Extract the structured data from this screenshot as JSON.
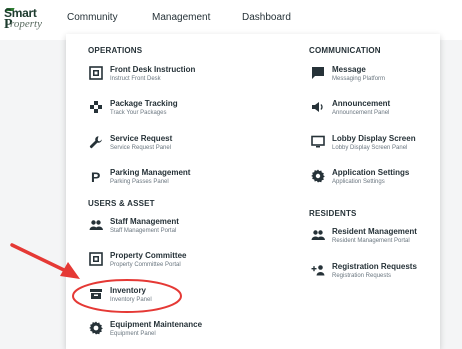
{
  "brand": {
    "line1": "Smart",
    "line2": "roperty",
    "initial": "P"
  },
  "nav": {
    "community": "Community",
    "management": "Management",
    "dashboard": "Dashboard"
  },
  "left": {
    "operations_heading": "OPERATIONS",
    "users_heading": "USERS & ASSET",
    "items": [
      {
        "title": "Front Desk Instruction",
        "sub": "Instruct Front Desk",
        "icon": "front-desk-icon"
      },
      {
        "title": "Package Tracking",
        "sub": "Track Your Packages",
        "icon": "package-icon"
      },
      {
        "title": "Service Request",
        "sub": "Service Request Panel",
        "icon": "wrench-icon"
      },
      {
        "title": "Parking Management",
        "sub": "Parking Passes Panel",
        "icon": "parking-icon"
      },
      {
        "title": "Staff Management",
        "sub": "Staff Management Portal",
        "icon": "people-icon"
      },
      {
        "title": "Property Committee",
        "sub": "Property Committee Portal",
        "icon": "committee-icon"
      },
      {
        "title": "Inventory",
        "sub": "Inventory Panel",
        "icon": "inventory-icon"
      },
      {
        "title": "Equipment Maintenance",
        "sub": "Equipment Panel",
        "icon": "gear-icon"
      }
    ]
  },
  "right": {
    "communication_heading": "COMMUNICATION",
    "residents_heading": "RESIDENTS",
    "items": [
      {
        "title": "Message",
        "sub": "Messaging Platform",
        "icon": "message-icon"
      },
      {
        "title": "Announcement",
        "sub": "Announcement Panel",
        "icon": "megaphone-icon"
      },
      {
        "title": "Lobby Display Screen",
        "sub": "Lobby Display Screen Panel",
        "icon": "monitor-icon"
      },
      {
        "title": "Application Settings",
        "sub": "Application Settings",
        "icon": "settings-icon"
      },
      {
        "title": "Resident Management",
        "sub": "Resident Management Portal",
        "icon": "people-icon"
      },
      {
        "title": "Registration Requests",
        "sub": "Registration Requests",
        "icon": "add-user-icon"
      }
    ]
  },
  "colors": {
    "text": "#263238",
    "annotation": "#e53935",
    "brand": "#1d3b2e"
  }
}
